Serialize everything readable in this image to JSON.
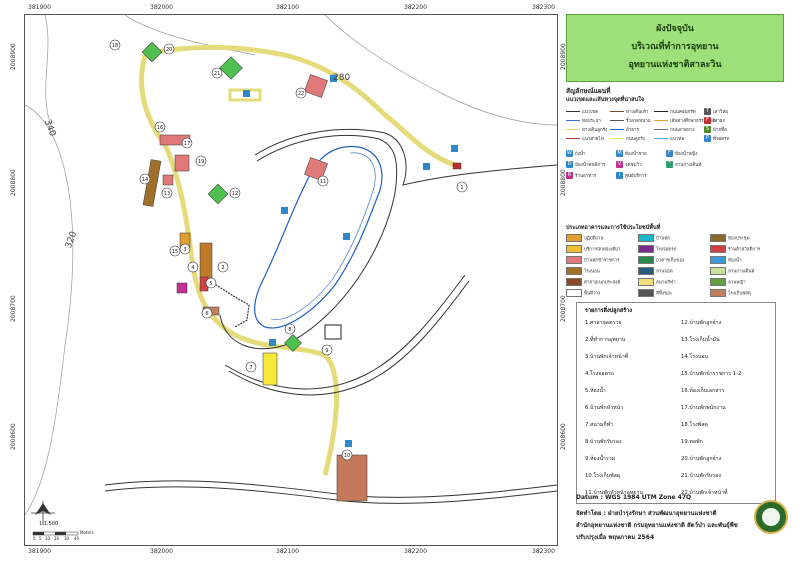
{
  "title": {
    "line1": "ผังปัจจุบัน",
    "line2": "บริเวณที่ทำการอุทยาน",
    "line3": "อุทยานแห่งชาติสาละวิน"
  },
  "grid": {
    "x_labels": [
      "381900",
      "382000",
      "382100",
      "382200",
      "382300"
    ],
    "y_labels": [
      "2008900",
      "2008800",
      "2008700",
      "2008600"
    ]
  },
  "contours": [
    "280",
    "340",
    "320"
  ],
  "scale": {
    "ratio": "1:1,500",
    "ticks": [
      "0",
      "5",
      "10",
      "20",
      "30",
      "40"
    ],
    "unit": "Meters"
  },
  "legend": {
    "heading": "สัญลักษณ์แผนที่",
    "sub1": "แนวเขตและเส้นทางจุดที่น่าสนใจ",
    "lines": [
      {
        "label": "แนวเขต",
        "color": "#333333"
      },
      {
        "label": "ทางเดินเท้า",
        "color": "#7a4b2a"
      },
      {
        "label": "ถนนคอนกรีต",
        "color": "#222222"
      },
      {
        "label": "ท่อประปา",
        "color": "#3c6fd1"
      },
      {
        "label": "รั้วลวดหนาม",
        "color": "#555555"
      },
      {
        "label": "เส้นทางศึกษาธรรมชาติ",
        "color": "#e0a030"
      },
      {
        "label": "ทางเดินลูกรัง",
        "color": "#e6d46a"
      },
      {
        "label": "ลำธาร",
        "color": "#1e5fc2"
      },
      {
        "label": "ถนนลาดยาง",
        "color": "#6b6b6b"
      },
      {
        "label": "แนวสายไฟ",
        "color": "#b03030"
      },
      {
        "label": "ถนนลูกรัง",
        "color": "#e9e07a"
      },
      {
        "label": "แนวท่อ",
        "color": "#4fa3e0"
      }
    ],
    "icons": [
      {
        "label": "เสาวิทยุ",
        "color": "#555555",
        "glyph": "T"
      },
      {
        "label": "เสาธง",
        "color": "#c03030",
        "glyph": "F"
      },
      {
        "label": "ป้ายชื่อ",
        "color": "#4f8a2b",
        "glyph": "S"
      },
      {
        "label": "ที่จอดรถ",
        "color": "#2d87c9",
        "glyph": "P"
      },
      {
        "label": "ถังน้ำ",
        "color": "#2d87c9",
        "glyph": "W"
      },
      {
        "label": "ห้องน้ำชาย",
        "color": "#2d87c9",
        "glyph": "M"
      },
      {
        "label": "ห้องน้ำหญิง",
        "color": "#2d87c9",
        "glyph": "F"
      },
      {
        "label": "ห้องน้ำคนพิการ",
        "color": "#2d87c9",
        "glyph": "D"
      },
      {
        "label": "จุดชมวิว",
        "color": "#c03090",
        "glyph": "V"
      },
      {
        "label": "ลานกางเต็นท์",
        "color": "#2d9c6a",
        "glyph": "^"
      },
      {
        "label": "ร้านอาหาร",
        "color": "#c03090",
        "glyph": "R"
      },
      {
        "label": "ศูนย์บริการ",
        "color": "#2d87c9",
        "glyph": "i"
      }
    ],
    "sub2": "ประเภทอาคารและการใช้ประโยชน์พื้นที่",
    "areas": [
      {
        "label": "ปฏิบัติงาน",
        "color": "#e0a030"
      },
      {
        "label": "บ้านพัก",
        "color": "#18b4c8"
      },
      {
        "label": "ห้องประชุม",
        "color": "#8a6a2a"
      },
      {
        "label": "บริการนักท่องเที่ยว",
        "color": "#f0c030"
      },
      {
        "label": "โรงจอดรถ",
        "color": "#7a2a8a"
      },
      {
        "label": "ร้านค้าสวัสดิการ",
        "color": "#d04040"
      },
      {
        "label": "บ้านพักข้าราชการ",
        "color": "#e07a7a"
      },
      {
        "label": "อาคารเก็บของ",
        "color": "#2a8a4a"
      },
      {
        "label": "ห้องน้ำ",
        "color": "#3c9ad6"
      },
      {
        "label": "โรงนอน",
        "color": "#a0702a"
      },
      {
        "label": "ลานจอด",
        "color": "#2a5a7a"
      },
      {
        "label": "ลานกางเต็นท์",
        "color": "#c8e0a0"
      },
      {
        "label": "ศาลาอเนกประสงค์",
        "color": "#8a4a2a"
      },
      {
        "label": "สนามกีฬา",
        "color": "#f0e080"
      },
      {
        "label": "ลานหญ้า",
        "color": "#60a040"
      },
      {
        "label": "พื้นที่ว่าง",
        "color": "#ffffff"
      },
      {
        "label": "ที่ทิ้งขยะ",
        "color": "#555555"
      },
      {
        "label": "โรงเก็บพัสดุ",
        "color": "#c08060"
      }
    ]
  },
  "buildings_heading": "รายการสิ่งปลูกสร้าง",
  "buildings": [
    "1.ศาลาจุดตรวจ",
    "2.ที่ทำการอุทยาน",
    "3.บ้านพักเจ้าหน้าที่",
    "4.โรงจอดรถ",
    "5.ห้องน้ำ",
    "6.บ้านพักหัวหน้า",
    "7.สนามกีฬา",
    "8.บ้านพักรับรอง",
    "9.ห้องน้ำรวม",
    "10.โรงเก็บพัสดุ",
    "11.บ้านพักหัวหน้าอุทยาน",
    "12.บ้านพักลูกจ้าง",
    "13.โรงเก็บน้ำมัน",
    "14.โรงนอน",
    "15.บ้านพักข้าราชการ 1-2",
    "16.ห้องเก็บเอกสาร",
    "17.บ้านพักพนักงาน",
    "18.โรงพัสดุ",
    "19.หอพัก",
    "20.บ้านพักลูกจ้าง",
    "21.บ้านพักรับรอง",
    "22.บ้านพักเจ้าหน้าที่"
  ],
  "datum": "Datum : WGS 1984 UTM Zone 47Q",
  "credit1": "จัดทำโดย : ฝ่ายบำรุงรักษา ส่วนพัฒนาอุทยานแห่งชาติ",
  "credit2": "สำนักอุทยานแห่งชาติ กรมอุทยานแห่งชาติ สัตว์ป่า และพันธุ์พืช",
  "credit3": "ปรับปรุงเมื่อ พฤษภาคม 2564",
  "map_labels": [
    "1",
    "2",
    "3",
    "4",
    "5",
    "6",
    "7",
    "8",
    "9",
    "10",
    "11",
    "12",
    "13",
    "14",
    "15",
    "16",
    "17",
    "18",
    "19",
    "20",
    "21",
    "22"
  ]
}
